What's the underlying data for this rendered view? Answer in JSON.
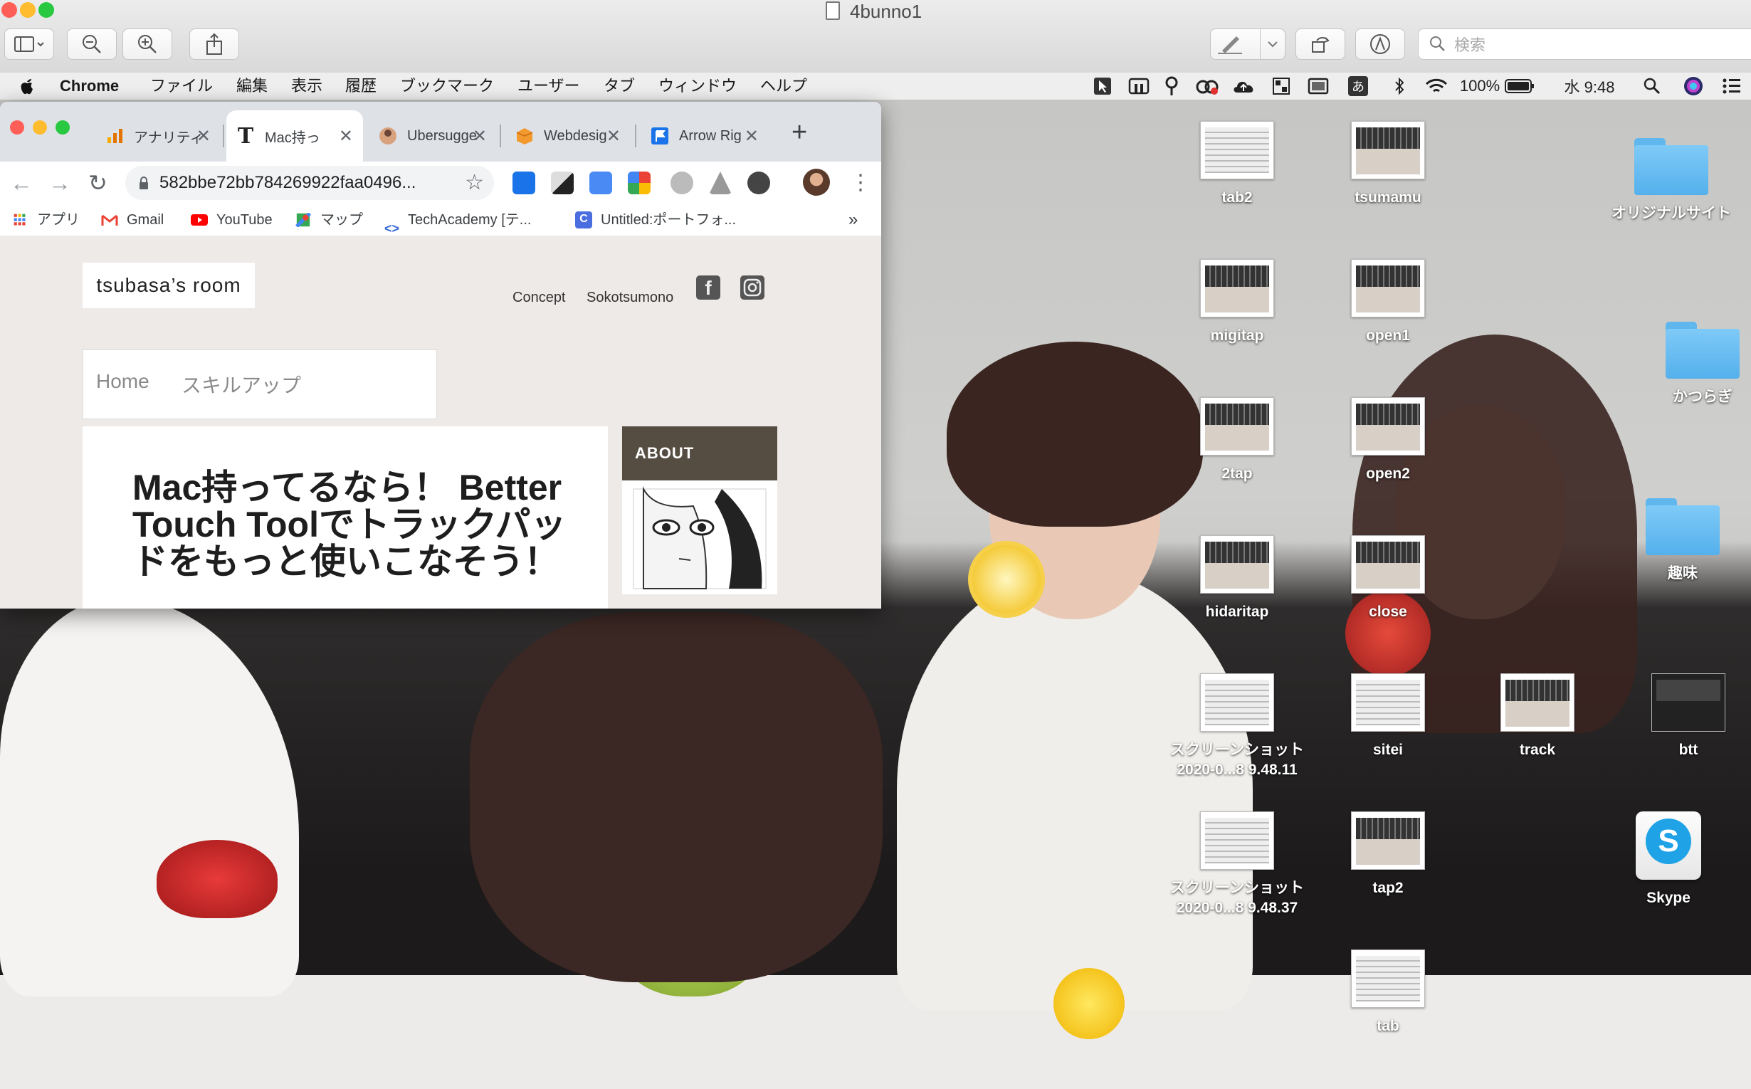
{
  "preview": {
    "title": "4bunno1",
    "search_placeholder": "検索"
  },
  "menubar": {
    "app": "Chrome",
    "items": [
      "ファイル",
      "編集",
      "表示",
      "履歴",
      "ブックマーク",
      "ユーザー",
      "タブ",
      "ウィンドウ",
      "ヘルプ"
    ],
    "ime": "あ",
    "battery": "100%",
    "clock": "水 9:48"
  },
  "chrome": {
    "tabs": [
      {
        "title": "アナリティ",
        "icon": "analytics-icon"
      },
      {
        "title": "Mac持っ",
        "icon": "t-letter-icon"
      },
      {
        "title": "Ubersugge",
        "icon": "ubersuggest-avatar-icon"
      },
      {
        "title": "Webdesig",
        "icon": "box-icon"
      },
      {
        "title": "Arrow Rig",
        "icon": "flag-icon"
      }
    ],
    "url": "582bbe72bb784269922faa0496...",
    "bookmarks": [
      "アプリ",
      "Gmail",
      "YouTube",
      "マップ",
      "TechAcademy [テ...",
      "Untitled:ポートフォ..."
    ],
    "more_bookmarks": "»"
  },
  "site": {
    "logo": "tsubasa’s room",
    "nav": [
      "Concept",
      "Sokotsumono"
    ],
    "facebook": "f",
    "menu": [
      "Home",
      "スキルアップ"
    ],
    "headline": "Mac持ってるなら！ Better Touch Toolでトラックパッドをもっと使いこなそう！",
    "about": "ABOUT"
  },
  "desktop_icons": [
    {
      "label": "tab2",
      "kind": "shot"
    },
    {
      "label": "tsumamu",
      "kind": "trackpad"
    },
    {
      "label": "migitap",
      "kind": "trackpad"
    },
    {
      "label": "open1",
      "kind": "trackpad"
    },
    {
      "label": "2tap",
      "kind": "trackpad"
    },
    {
      "label": "open2",
      "kind": "trackpad"
    },
    {
      "label": "hidaritap",
      "kind": "trackpad"
    },
    {
      "label": "close",
      "kind": "trackpad"
    },
    {
      "label": "スクリーンショット 2020-0...8 9.48.11",
      "kind": "shot"
    },
    {
      "label": "sitei",
      "kind": "shot"
    },
    {
      "label": "track",
      "kind": "trackpad"
    },
    {
      "label": "btt",
      "kind": "dark"
    },
    {
      "label": "スクリーンショット 2020-0...8 9.48.37",
      "kind": "shot"
    },
    {
      "label": "tap2",
      "kind": "trackpad"
    },
    {
      "label": "tab",
      "kind": "shot"
    }
  ],
  "folders": [
    "オリジナルサイト",
    "かつらぎ",
    "趣味"
  ],
  "skype": "Skype",
  "colors": {
    "close": "#ff5f57",
    "minimize": "#febc2e",
    "zoom": "#28c840",
    "folder": "#5fb7ee",
    "about_bg": "#554d42"
  }
}
